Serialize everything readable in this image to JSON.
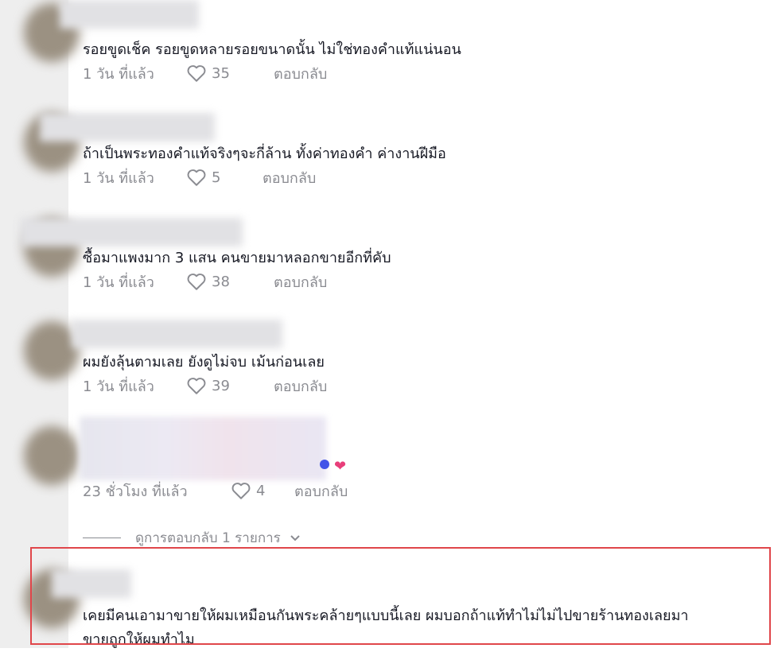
{
  "comments": [
    {
      "text": "รอยขูดเช็ค รอยขูดหลายรอยขนาดนั้น ไม่ใช่ทองคำแท้แน่นอน",
      "time": "1 วัน ที่แล้ว",
      "likes": "35",
      "reply": "ตอบกลับ"
    },
    {
      "text": "ถ้าเป็นพระทองคำแท้จริงๆจะกี่ล้าน ทั้งค่าทองคำ ค่างานฝีมือ",
      "time": "1 วัน ที่แล้ว",
      "likes": "5",
      "reply": "ตอบกลับ"
    },
    {
      "text": "ซื้อมาแพงมาก 3 แสน คนขายมาหลอกขายอีกที่คับ",
      "time": "1 วัน ที่แล้ว",
      "likes": "38",
      "reply": "ตอบกลับ"
    },
    {
      "text": "ผมยังลุ้นตามเลย ยังดูไม่จบ เม้นก่อนเลย",
      "time": "1 วัน ที่แล้ว",
      "likes": "39",
      "reply": "ตอบกลับ"
    },
    {
      "text": "",
      "time": "23 ชั่วโมง ที่แล้ว",
      "likes": "4",
      "reply": "ตอบกลับ"
    }
  ],
  "view_replies": "ดูการตอบกลับ 1 รายการ",
  "last_comment": {
    "line1": "เคยมีคนเอามาขายให้ผมเหมือนกันพระคล้ายๆแบบนี้เลย ผมบอกถ้าแท้ทำไม่ไม่ไปขายร้านทองเลยมา",
    "line2": "ขายถูกให้ผมทำไม"
  },
  "colors": {
    "highlight": "#e0464a",
    "text": "#161823",
    "muted": "#8a8b91"
  },
  "icons": {
    "like": "heart-outline-icon",
    "expand": "chevron-down-icon"
  }
}
